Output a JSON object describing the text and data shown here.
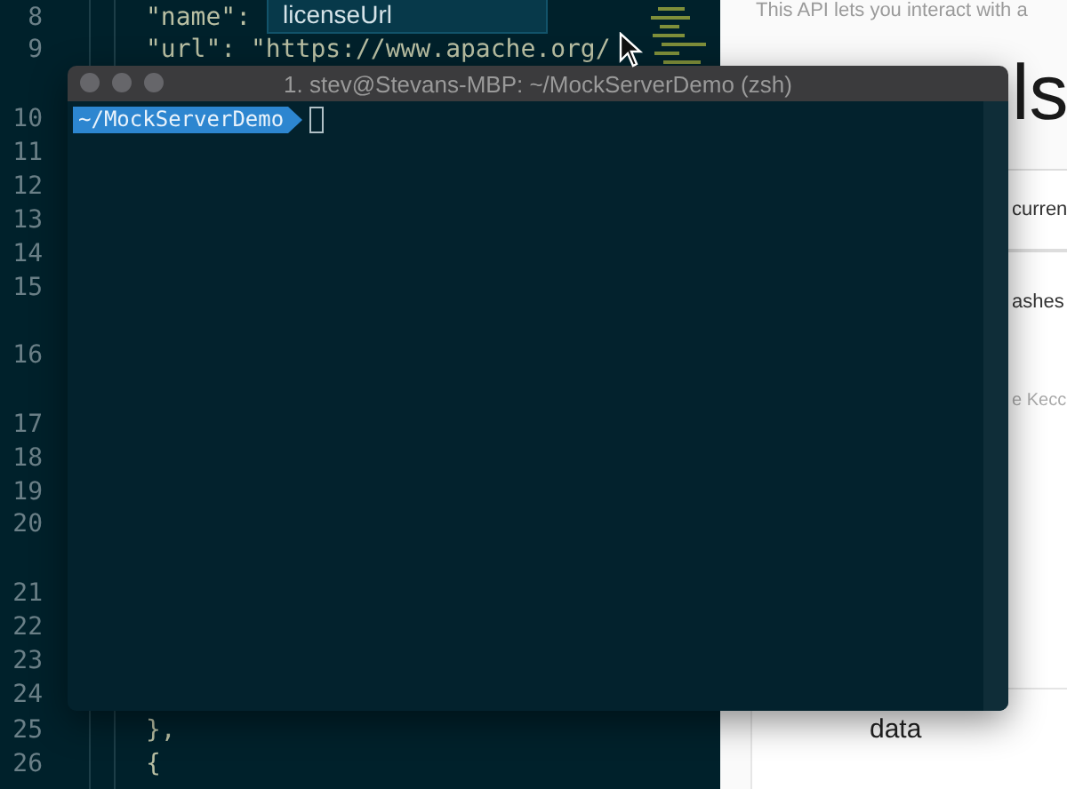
{
  "editor": {
    "lines": [
      {
        "number": "8",
        "wrapped": false,
        "code": "\"name\":"
      },
      {
        "number": "9",
        "wrapped": true,
        "code": "\"url\": \"https://www.apache.org/"
      },
      {
        "number": "10",
        "wrapped": false
      },
      {
        "number": "11",
        "wrapped": false
      },
      {
        "number": "12",
        "wrapped": false
      },
      {
        "number": "13",
        "wrapped": false
      },
      {
        "number": "14",
        "wrapped": false
      },
      {
        "number": "15",
        "wrapped": true
      },
      {
        "number": "16",
        "wrapped": true
      },
      {
        "number": "17",
        "wrapped": false
      },
      {
        "number": "18",
        "wrapped": false
      },
      {
        "number": "19",
        "wrapped": false
      },
      {
        "number": "20",
        "wrapped": true
      },
      {
        "number": "21",
        "wrapped": false
      },
      {
        "number": "22",
        "wrapped": false
      },
      {
        "number": "23",
        "wrapped": false
      },
      {
        "number": "24",
        "wrapped": false
      },
      {
        "number": "25",
        "wrapped": false,
        "code": "},"
      },
      {
        "number": "26",
        "wrapped": false,
        "code": "{"
      }
    ],
    "suggestion": {
      "label": "licenseUrl"
    }
  },
  "terminal": {
    "title": "1. stev@Stevans-MBP: ~/MockServerDemo (zsh)",
    "prompt": {
      "path": "~/MockServerDemo"
    }
  },
  "page": {
    "intro": "This API lets you interact with a",
    "heading": "ls",
    "cells": [
      {
        "text": "curren",
        "kind": "tab"
      },
      {
        "text": "ashes",
        "kind": "body"
      },
      {
        "text": "e Kecc",
        "kind": "hint"
      },
      {
        "text": "data",
        "kind": "bottom"
      }
    ]
  }
}
